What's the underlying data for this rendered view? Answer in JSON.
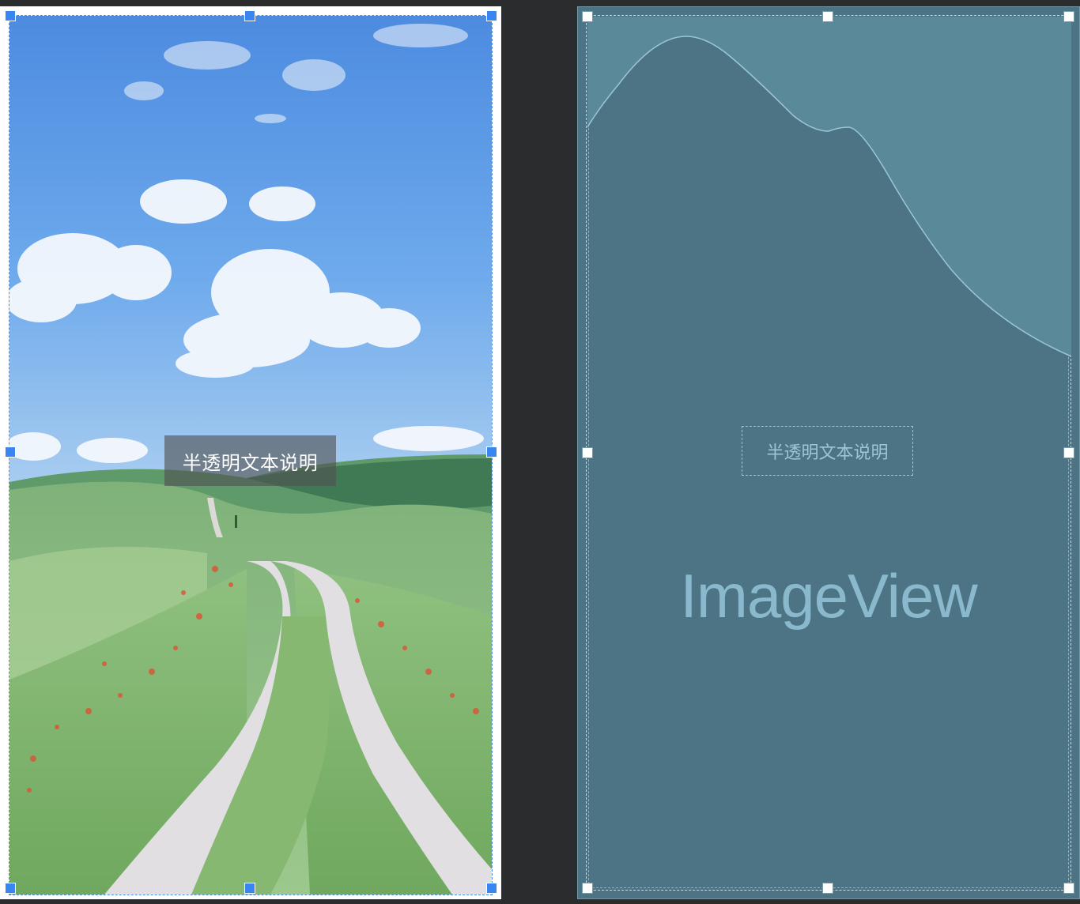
{
  "design_preview": {
    "caption_text": "半透明文本说明",
    "colors": {
      "selection": "#3a86f0",
      "caption_background": "rgba(80,80,80,0.62)",
      "caption_text": "#ffffff"
    }
  },
  "blueprint": {
    "caption_text": "半透明文本说明",
    "view_label": "ImageView",
    "colors": {
      "background": "#4c7484",
      "curve_fill": "#5a8a9a",
      "curve_line": "#9cc6d6",
      "label": "#8ab8cc"
    }
  }
}
